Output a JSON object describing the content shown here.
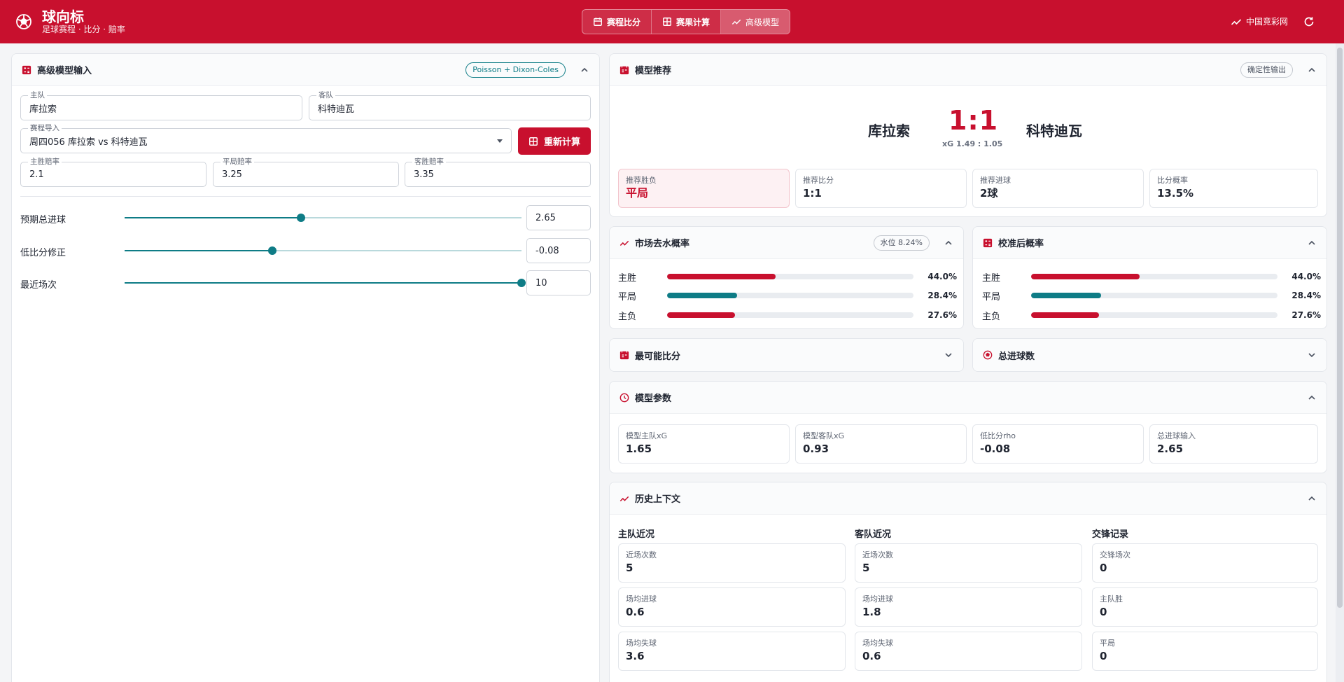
{
  "header": {
    "title": "球向标",
    "subtitle": "足球赛程 · 比分 · 赔率",
    "tabs": [
      {
        "label": "赛程比分",
        "active": false
      },
      {
        "label": "赛果计算",
        "active": false
      },
      {
        "label": "高级模型",
        "active": true
      }
    ],
    "external_link": "中国竞彩网"
  },
  "input_panel": {
    "title": "高级模型输入",
    "badge": "Poisson + Dixon-Coles",
    "home_label": "主队",
    "home_value": "库拉索",
    "away_label": "客队",
    "away_value": "科特迪瓦",
    "fixture_label": "赛程导入",
    "fixture_value": "周四056 库拉索 vs 科特迪瓦",
    "recalc_button": "重新计算",
    "odds": [
      {
        "label": "主胜赔率",
        "value": "2.1"
      },
      {
        "label": "平局赔率",
        "value": "3.25"
      },
      {
        "label": "客胜赔率",
        "value": "3.35"
      }
    ],
    "sliders": [
      {
        "label": "预期总进球",
        "value": "2.65",
        "fraction": 0.445
      },
      {
        "label": "低比分修正",
        "value": "-0.08",
        "fraction": 0.372
      },
      {
        "label": "最近场次",
        "value": "10",
        "fraction": 1.0
      }
    ]
  },
  "recommend": {
    "title": "模型推荐",
    "badge": "确定性输出",
    "home": "库拉索",
    "away": "科特迪瓦",
    "score": "1:1",
    "xg": "xG 1.49 : 1.05",
    "stats": [
      {
        "label": "推荐胜负",
        "value": "平局"
      },
      {
        "label": "推荐比分",
        "value": "1:1"
      },
      {
        "label": "推荐进球",
        "value": "2球"
      },
      {
        "label": "比分概率",
        "value": "13.5%"
      }
    ]
  },
  "market": {
    "title": "市场去水概率",
    "badge": "水位 8.24%",
    "rows": [
      {
        "label": "主胜",
        "value": "44.0%",
        "fraction": 0.44,
        "color": "#c8102e"
      },
      {
        "label": "平局",
        "value": "28.4%",
        "fraction": 0.284,
        "color": "#0e7c86"
      },
      {
        "label": "主负",
        "value": "27.6%",
        "fraction": 0.276,
        "color": "#c8102e"
      }
    ]
  },
  "calibrated": {
    "title": "校准后概率",
    "rows": [
      {
        "label": "主胜",
        "value": "44.0%",
        "fraction": 0.44,
        "color": "#c8102e"
      },
      {
        "label": "平局",
        "value": "28.4%",
        "fraction": 0.284,
        "color": "#0e7c86"
      },
      {
        "label": "主负",
        "value": "27.6%",
        "fraction": 0.276,
        "color": "#c8102e"
      }
    ]
  },
  "likely_scores": {
    "title": "最可能比分"
  },
  "total_goals": {
    "title": "总进球数"
  },
  "params": {
    "title": "模型参数",
    "stats": [
      {
        "label": "模型主队xG",
        "value": "1.65"
      },
      {
        "label": "模型客队xG",
        "value": "0.93"
      },
      {
        "label": "低比分rho",
        "value": "-0.08"
      },
      {
        "label": "总进球输入",
        "value": "2.65"
      }
    ]
  },
  "history": {
    "title": "历史上下文",
    "columns": [
      {
        "title": "主队近况",
        "items": [
          {
            "label": "近场次数",
            "value": "5"
          },
          {
            "label": "场均进球",
            "value": "0.6"
          },
          {
            "label": "场均失球",
            "value": "3.6"
          }
        ]
      },
      {
        "title": "客队近况",
        "items": [
          {
            "label": "近场次数",
            "value": "5"
          },
          {
            "label": "场均进球",
            "value": "1.8"
          },
          {
            "label": "场均失球",
            "value": "0.6"
          }
        ]
      },
      {
        "title": "交锋记录",
        "items": [
          {
            "label": "交锋场次",
            "value": "0"
          },
          {
            "label": "主队胜",
            "value": "0"
          },
          {
            "label": "平局",
            "value": "0"
          }
        ]
      }
    ]
  },
  "colors": {
    "brand": "#c8102e",
    "accent": "#0e7c86"
  }
}
